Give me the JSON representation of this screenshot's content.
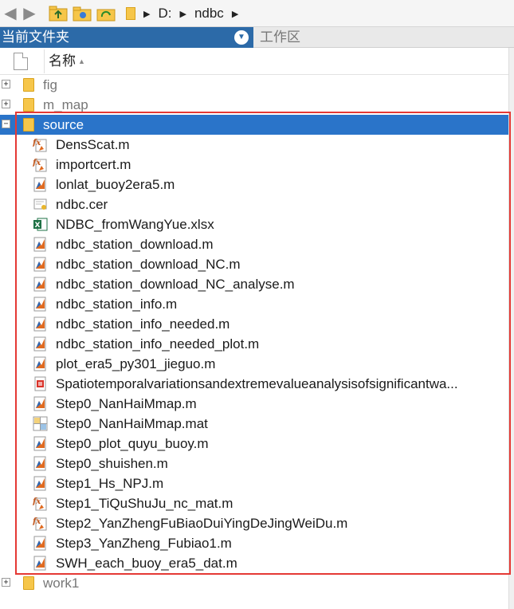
{
  "toolbar": {
    "back_icon": "back-arrow-icon",
    "forward_icon": "forward-arrow-icon",
    "path_segments": [
      "D:",
      "ndbc"
    ]
  },
  "panels": {
    "current_folder": "当前文件夹",
    "workspace": "工作区"
  },
  "columns": {
    "name": "名称"
  },
  "colors": {
    "header_bg": "#2c6aa8",
    "selected_bg": "#2a74c9",
    "highlight_border": "#e53935",
    "folder": "#f6c64a"
  },
  "tree": {
    "folders_top": [
      {
        "name": "fig",
        "expander": "+"
      },
      {
        "name": "m_map",
        "expander": "+"
      }
    ],
    "source": {
      "name": "source",
      "expander": "−"
    },
    "files": [
      {
        "name": "DensScat.m",
        "icon": "function-fx-icon"
      },
      {
        "name": "importcert.m",
        "icon": "function-fx-icon"
      },
      {
        "name": "lonlat_buoy2era5.m",
        "icon": "matlab-script-icon"
      },
      {
        "name": "ndbc.cer",
        "icon": "certificate-icon"
      },
      {
        "name": "NDBC_fromWangYue.xlsx",
        "icon": "excel-icon"
      },
      {
        "name": "ndbc_station_download.m",
        "icon": "matlab-script-icon"
      },
      {
        "name": "ndbc_station_download_NC.m",
        "icon": "matlab-script-icon"
      },
      {
        "name": "ndbc_station_download_NC_analyse.m",
        "icon": "matlab-script-icon"
      },
      {
        "name": "ndbc_station_info.m",
        "icon": "matlab-script-icon"
      },
      {
        "name": "ndbc_station_info_needed.m",
        "icon": "matlab-script-icon"
      },
      {
        "name": "ndbc_station_info_needed_plot.m",
        "icon": "matlab-script-icon"
      },
      {
        "name": "plot_era5_py301_jieguo.m",
        "icon": "matlab-script-icon"
      },
      {
        "name": "Spatiotemporalvariationsandextremevalueanalysisofsignificantwa...",
        "icon": "pdf-icon"
      },
      {
        "name": "Step0_NanHaiMmap.m",
        "icon": "matlab-script-icon"
      },
      {
        "name": "Step0_NanHaiMmap.mat",
        "icon": "mat-file-icon"
      },
      {
        "name": "Step0_plot_quyu_buoy.m",
        "icon": "matlab-script-icon"
      },
      {
        "name": "Step0_shuishen.m",
        "icon": "matlab-script-icon"
      },
      {
        "name": "Step1_Hs_NPJ.m",
        "icon": "matlab-script-icon"
      },
      {
        "name": "Step1_TiQuShuJu_nc_mat.m",
        "icon": "function-fx-icon"
      },
      {
        "name": "Step2_YanZhengFuBiaoDuiYingDeJingWeiDu.m",
        "icon": "function-fx-icon"
      },
      {
        "name": "Step3_YanZheng_Fubiao1.m",
        "icon": "matlab-script-icon"
      },
      {
        "name": "SWH_each_buoy_era5_dat.m",
        "icon": "matlab-script-icon"
      }
    ],
    "folders_bottom": [
      {
        "name": "work1",
        "expander": "+"
      }
    ]
  }
}
